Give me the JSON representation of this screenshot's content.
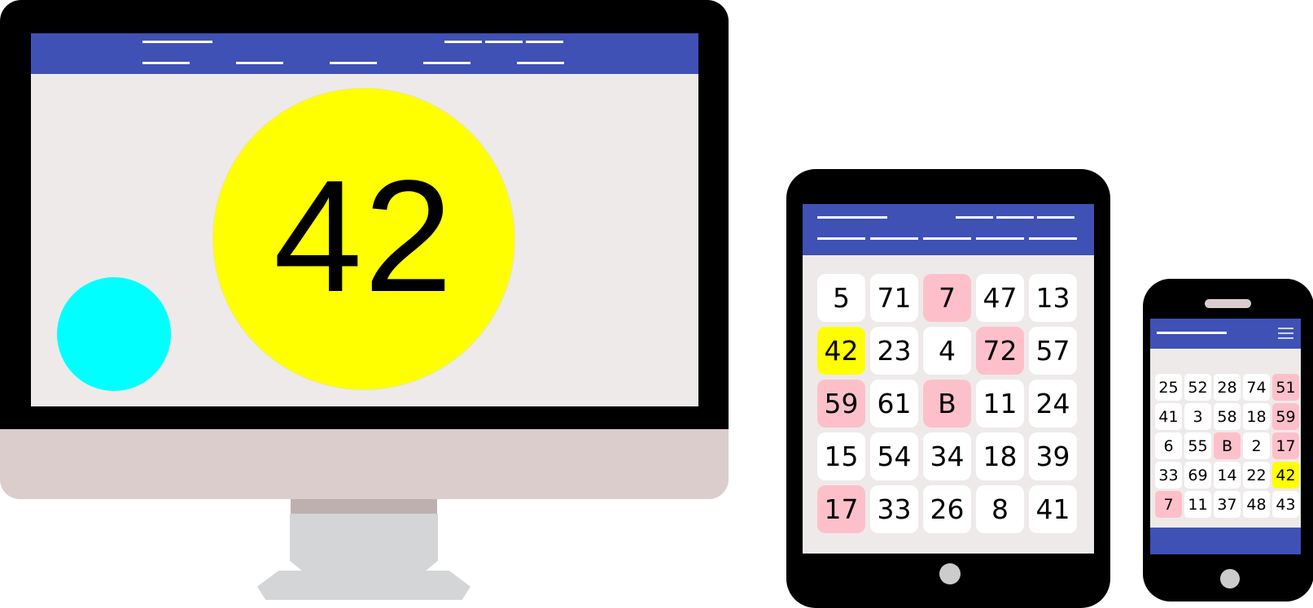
{
  "desktop": {
    "called_number": "42"
  },
  "tablet": {
    "bingo_card": [
      [
        {
          "v": "5"
        },
        {
          "v": "71"
        },
        {
          "v": "7",
          "s": "pink"
        },
        {
          "v": "47"
        },
        {
          "v": "13"
        }
      ],
      [
        {
          "v": "42",
          "s": "yellow"
        },
        {
          "v": "23"
        },
        {
          "v": "4"
        },
        {
          "v": "72",
          "s": "pink"
        },
        {
          "v": "57"
        }
      ],
      [
        {
          "v": "59",
          "s": "pink"
        },
        {
          "v": "61"
        },
        {
          "v": "B",
          "s": "pink"
        },
        {
          "v": "11"
        },
        {
          "v": "24"
        }
      ],
      [
        {
          "v": "15"
        },
        {
          "v": "54"
        },
        {
          "v": "34"
        },
        {
          "v": "18"
        },
        {
          "v": "39"
        }
      ],
      [
        {
          "v": "17",
          "s": "pink"
        },
        {
          "v": "33"
        },
        {
          "v": "26"
        },
        {
          "v": "8"
        },
        {
          "v": "41"
        }
      ]
    ]
  },
  "phone": {
    "bingo_card": [
      [
        {
          "v": "25"
        },
        {
          "v": "52"
        },
        {
          "v": "28"
        },
        {
          "v": "74"
        },
        {
          "v": "51",
          "s": "pink"
        }
      ],
      [
        {
          "v": "41"
        },
        {
          "v": "3"
        },
        {
          "v": "58"
        },
        {
          "v": "18"
        },
        {
          "v": "59",
          "s": "pink"
        }
      ],
      [
        {
          "v": "6"
        },
        {
          "v": "55"
        },
        {
          "v": "B",
          "s": "pink"
        },
        {
          "v": "2"
        },
        {
          "v": "17",
          "s": "pink"
        }
      ],
      [
        {
          "v": "33"
        },
        {
          "v": "69"
        },
        {
          "v": "14"
        },
        {
          "v": "22"
        },
        {
          "v": "42",
          "s": "yellow"
        }
      ],
      [
        {
          "v": "7",
          "s": "pink"
        },
        {
          "v": "11"
        },
        {
          "v": "37"
        },
        {
          "v": "48"
        },
        {
          "v": "43"
        }
      ]
    ]
  },
  "colors": {
    "nav": "#3f51b5",
    "called_ball": "#ffff00",
    "secondary_ball": "#00ffff",
    "marked_cell": "#fdc0cb",
    "current_cell": "#ffff00",
    "screen_bg": "#eeeaea"
  },
  "icons": [
    "hamburger-menu-icon",
    "home-button-icon"
  ]
}
